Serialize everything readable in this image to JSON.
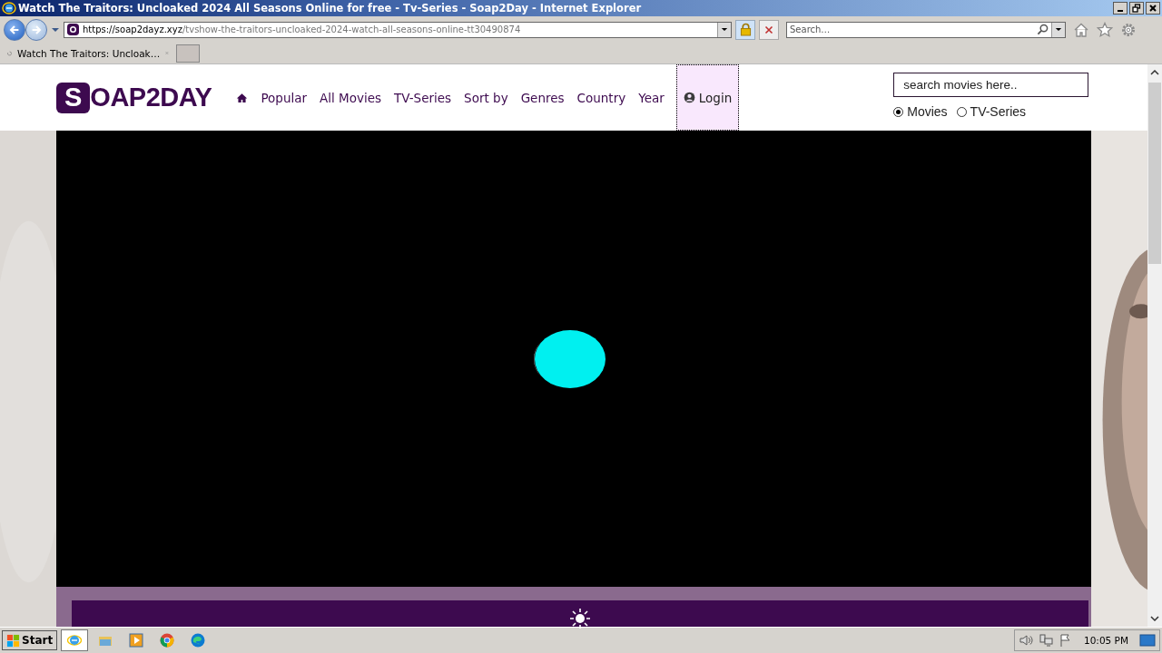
{
  "window": {
    "title": "Watch The Traitors: Uncloaked 2024 All Seasons Online for free - Tv-Series - Soap2Day - Internet Explorer"
  },
  "address_bar": {
    "host": "https://soap2dayz.xyz",
    "path": "/tvshow-the-traitors-uncloaked-2024-watch-all-seasons-online-tt30490874"
  },
  "search": {
    "placeholder": "Search…"
  },
  "tabs": [
    {
      "label": "Watch The Traitors: Uncloak…"
    }
  ],
  "site": {
    "logo": {
      "boxed": "S",
      "rest": "OAP2DAY"
    },
    "nav_items": [
      "Popular",
      "All Movies",
      "TV-Series",
      "Sort by",
      "Genres",
      "Country",
      "Year"
    ],
    "login": {
      "label": "Login",
      "focused": true
    },
    "search": {
      "placeholder": "search movies here.."
    },
    "search_type": [
      {
        "label": "Movies",
        "selected": true
      },
      {
        "label": "TV-Series",
        "selected": false
      }
    ]
  },
  "taskbar": {
    "start": "Start",
    "clock": "10:05 PM"
  }
}
